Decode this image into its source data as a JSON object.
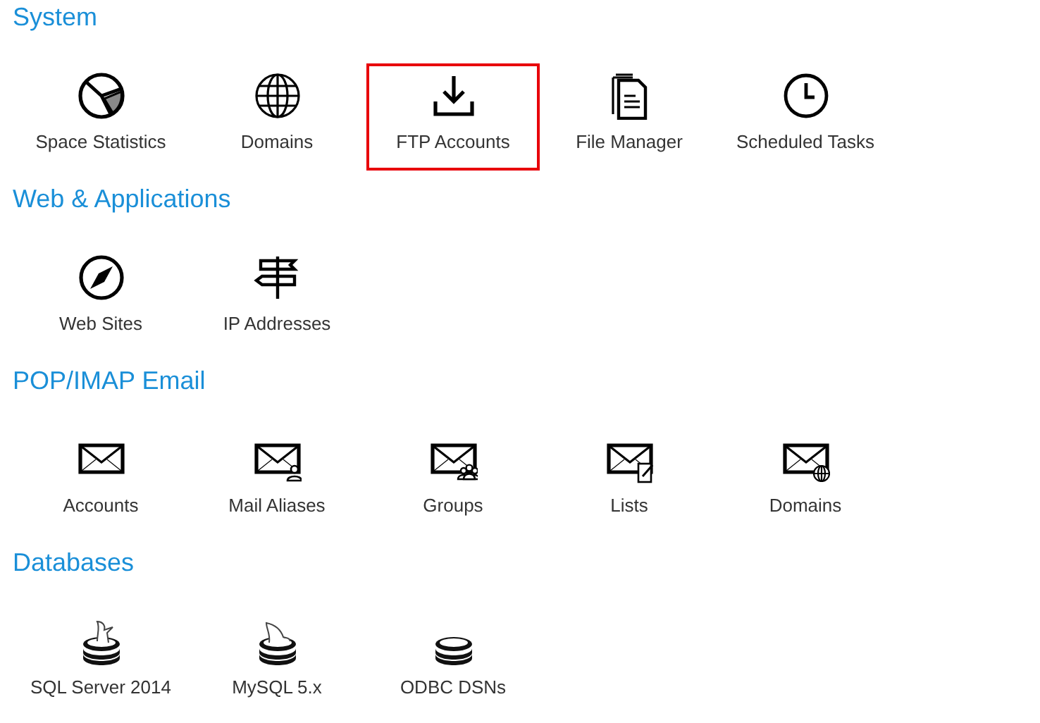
{
  "sections": [
    {
      "title": "System",
      "tiles": [
        {
          "label": "Space Statistics",
          "kind": "pie",
          "selected": false
        },
        {
          "label": "Domains",
          "kind": "globe",
          "selected": false
        },
        {
          "label": "FTP Accounts",
          "kind": "download",
          "selected": true
        },
        {
          "label": "File Manager",
          "kind": "files",
          "selected": false
        },
        {
          "label": "Scheduled Tasks",
          "kind": "clock",
          "selected": false
        }
      ]
    },
    {
      "title": "Web & Applications",
      "tiles": [
        {
          "label": "Web Sites",
          "kind": "compass",
          "selected": false
        },
        {
          "label": "IP Addresses",
          "kind": "signpost",
          "selected": false
        }
      ]
    },
    {
      "title": "POP/IMAP Email",
      "tiles": [
        {
          "label": "Accounts",
          "kind": "mail",
          "selected": false
        },
        {
          "label": "Mail Aliases",
          "kind": "mail-user",
          "selected": false
        },
        {
          "label": "Groups",
          "kind": "mail-group",
          "selected": false
        },
        {
          "label": "Lists",
          "kind": "mail-list",
          "selected": false
        },
        {
          "label": "Domains",
          "kind": "mail-globe",
          "selected": false
        }
      ]
    },
    {
      "title": "Databases",
      "tiles": [
        {
          "label": "SQL Server 2014",
          "kind": "db-sql",
          "selected": false
        },
        {
          "label": "MySQL 5.x",
          "kind": "db-mysql",
          "selected": false
        },
        {
          "label": "ODBC DSNs",
          "kind": "db",
          "selected": false
        }
      ]
    }
  ]
}
